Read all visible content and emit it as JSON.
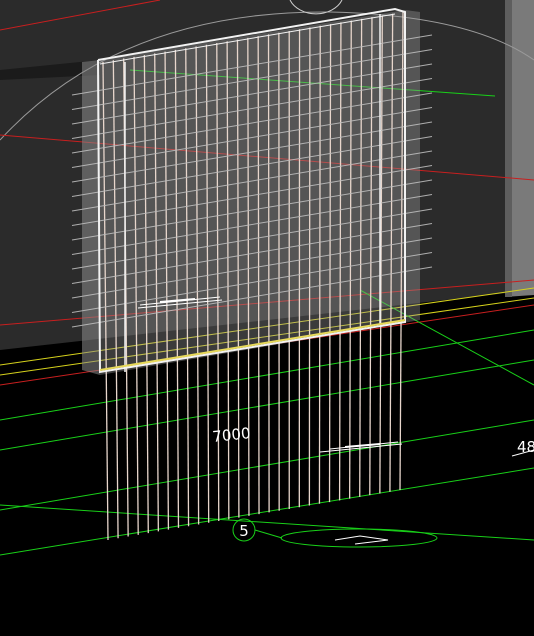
{
  "viewport": {
    "background": "#000000",
    "wall_color": "#2a2a2a",
    "rebar_color": "#e8d6cc",
    "line_colors": {
      "green": "#19d019",
      "red": "#c81f1f",
      "yellow": "#d6d21c",
      "grey": "#9a9a9a"
    }
  },
  "annotations": {
    "dimension_label": "7000",
    "grid_bubble_label": "5",
    "edge_label": "48"
  }
}
